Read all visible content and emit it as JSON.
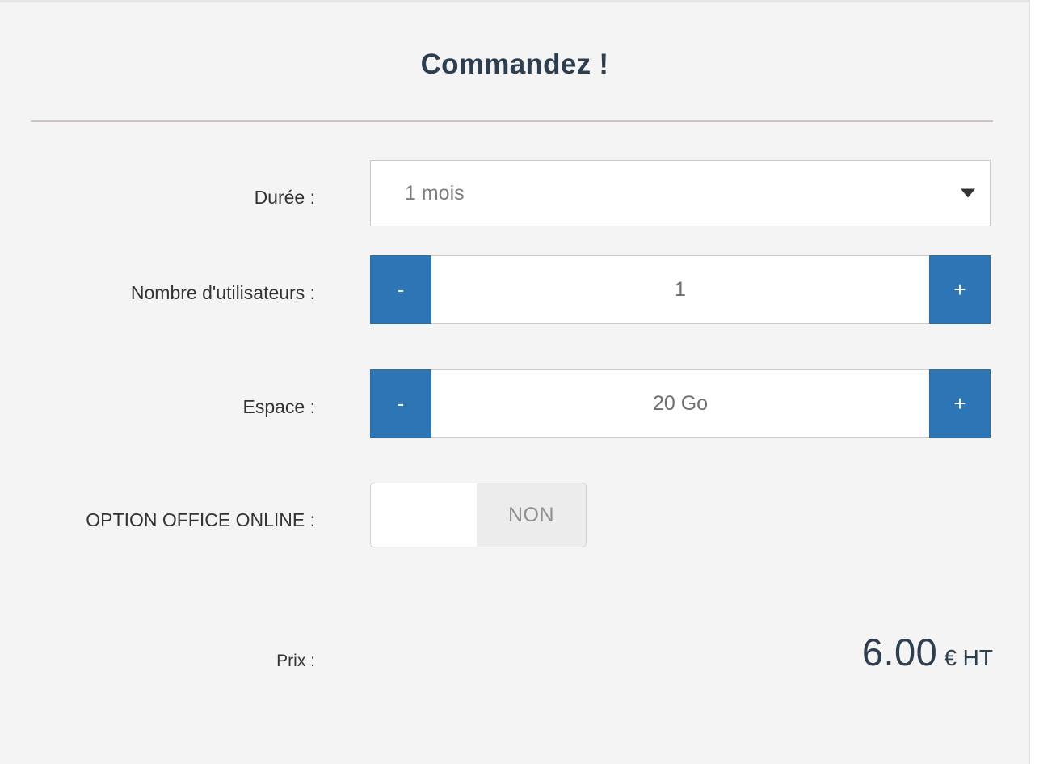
{
  "panel": {
    "title": "Commandez !"
  },
  "fields": {
    "duration": {
      "label": "Durée :",
      "value": "1 mois",
      "arrow_icon": "chevron-down-icon"
    },
    "users": {
      "label": "Nombre d'utilisateurs :",
      "decrement_label": "-",
      "value": "1",
      "increment_label": "+"
    },
    "space": {
      "label": "Espace :",
      "decrement_label": "-",
      "value": "20 Go",
      "increment_label": "+"
    },
    "office_option": {
      "label": "OPTION OFFICE ONLINE :",
      "state_label": "NON"
    },
    "price": {
      "label": "Prix :",
      "amount": "6.00",
      "currency": "€ HT"
    }
  },
  "colors": {
    "accent_blue": "#2e75b6",
    "title_navy": "#2c3e50",
    "panel_bg": "#f4f4f4",
    "rule": "#cfc0c3"
  }
}
